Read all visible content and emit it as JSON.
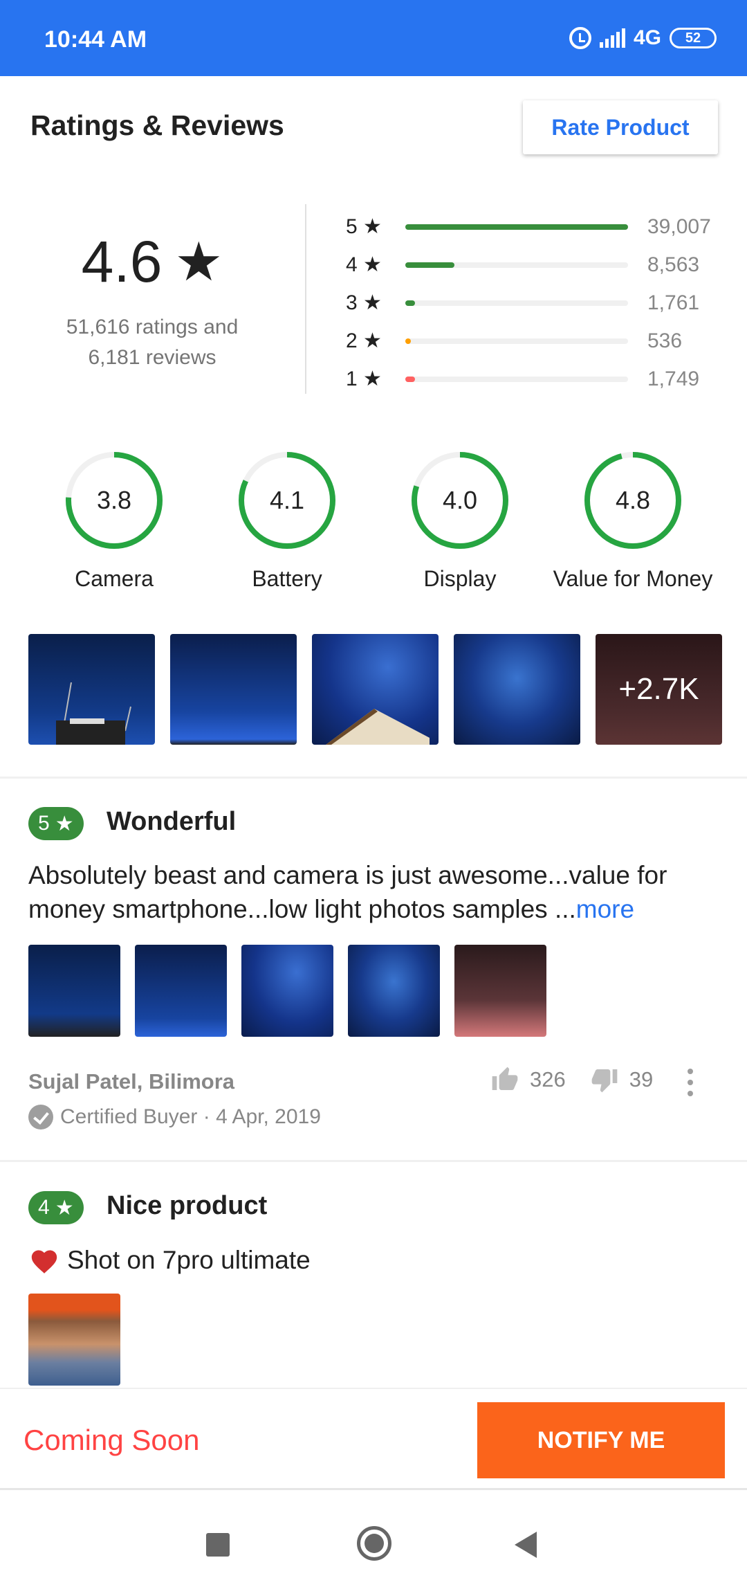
{
  "status_bar": {
    "time": "10:44 AM",
    "network": "4G",
    "battery": "52"
  },
  "header": {
    "title": "Ratings & Reviews",
    "rate_button": "Rate Product"
  },
  "summary": {
    "average": "4.6",
    "star_glyph": "★",
    "ratings_line": "51,616 ratings and",
    "reviews_line": "6,181 reviews"
  },
  "distribution": [
    {
      "label": "5 ★",
      "count": "39,007",
      "fraction": 1.0,
      "color": "#388e3c"
    },
    {
      "label": "4 ★",
      "count": "8,563",
      "fraction": 0.22,
      "color": "#388e3c"
    },
    {
      "label": "3 ★",
      "count": "1,761",
      "fraction": 0.045,
      "color": "#388e3c"
    },
    {
      "label": "2 ★",
      "count": "536",
      "fraction": 0.014,
      "color": "#ff9f00"
    },
    {
      "label": "1 ★",
      "count": "1,749",
      "fraction": 0.045,
      "color": "#ff6161"
    }
  ],
  "aspects": [
    {
      "name": "Camera",
      "value": "3.8",
      "fraction": 0.76
    },
    {
      "name": "Battery",
      "value": "4.1",
      "fraction": 0.82
    },
    {
      "name": "Display",
      "value": "4.0",
      "fraction": 0.8
    },
    {
      "name": "Value for Money",
      "value": "4.8",
      "fraction": 0.96
    }
  ],
  "gallery": {
    "more_label": "+2.7K"
  },
  "review1": {
    "rating": "5",
    "title": "Wonderful",
    "text": "Absolutely beast and camera is just awesome...value for money smartphone...low light photos samples ...",
    "more": "more",
    "author": "Sujal Patel, Bilimora",
    "certified": "Certified Buyer · 4 Apr, 2019",
    "likes": "326",
    "dislikes": "39"
  },
  "review2": {
    "rating": "4",
    "title": "Nice product",
    "text": "Shot on 7pro ultimate"
  },
  "bottom": {
    "status": "Coming Soon",
    "notify_button": "NOTIFY ME"
  },
  "colors": {
    "brand_blue": "#2874f0",
    "green": "#388e3c",
    "orange": "#fb641b",
    "red": "#ff4343"
  }
}
